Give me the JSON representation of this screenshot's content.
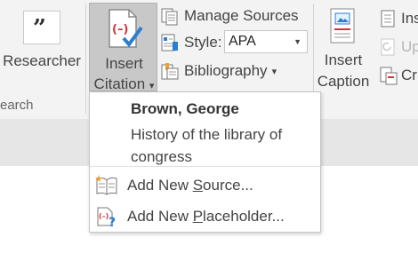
{
  "ribbon": {
    "researcher_label": "Researcher",
    "group_label": "earch",
    "insert_citation": {
      "line1": "Insert",
      "line2": "Citation",
      "dropdown_arrow": "▾"
    },
    "manage_sources": "Manage Sources",
    "style_label": "Style:",
    "style_value": "APA",
    "bibliography": "Bibliography",
    "insert_caption": {
      "line1": "Insert",
      "line2": "Caption"
    },
    "right_items": [
      "Ins",
      "Up",
      "Cr"
    ]
  },
  "dropdown": {
    "citation": {
      "author": "Brown, George",
      "title": "History of the library of congress"
    },
    "add_source": {
      "pre": "Add New ",
      "key": "S",
      "post": "ource..."
    },
    "add_placeholder": {
      "pre": "Add New ",
      "key": "P",
      "post": "laceholder..."
    }
  },
  "colors": {
    "accent_blue": "#2b7cd3",
    "citation_red": "#d13438",
    "ribbon_bg": "#f3f3f3",
    "pressed_bg": "#c8c8c8"
  },
  "icons": [
    "researcher-icon",
    "insert-citation-icon",
    "manage-sources-icon",
    "style-icon",
    "bibliography-icon",
    "insert-caption-icon",
    "add-source-icon",
    "add-placeholder-icon"
  ]
}
